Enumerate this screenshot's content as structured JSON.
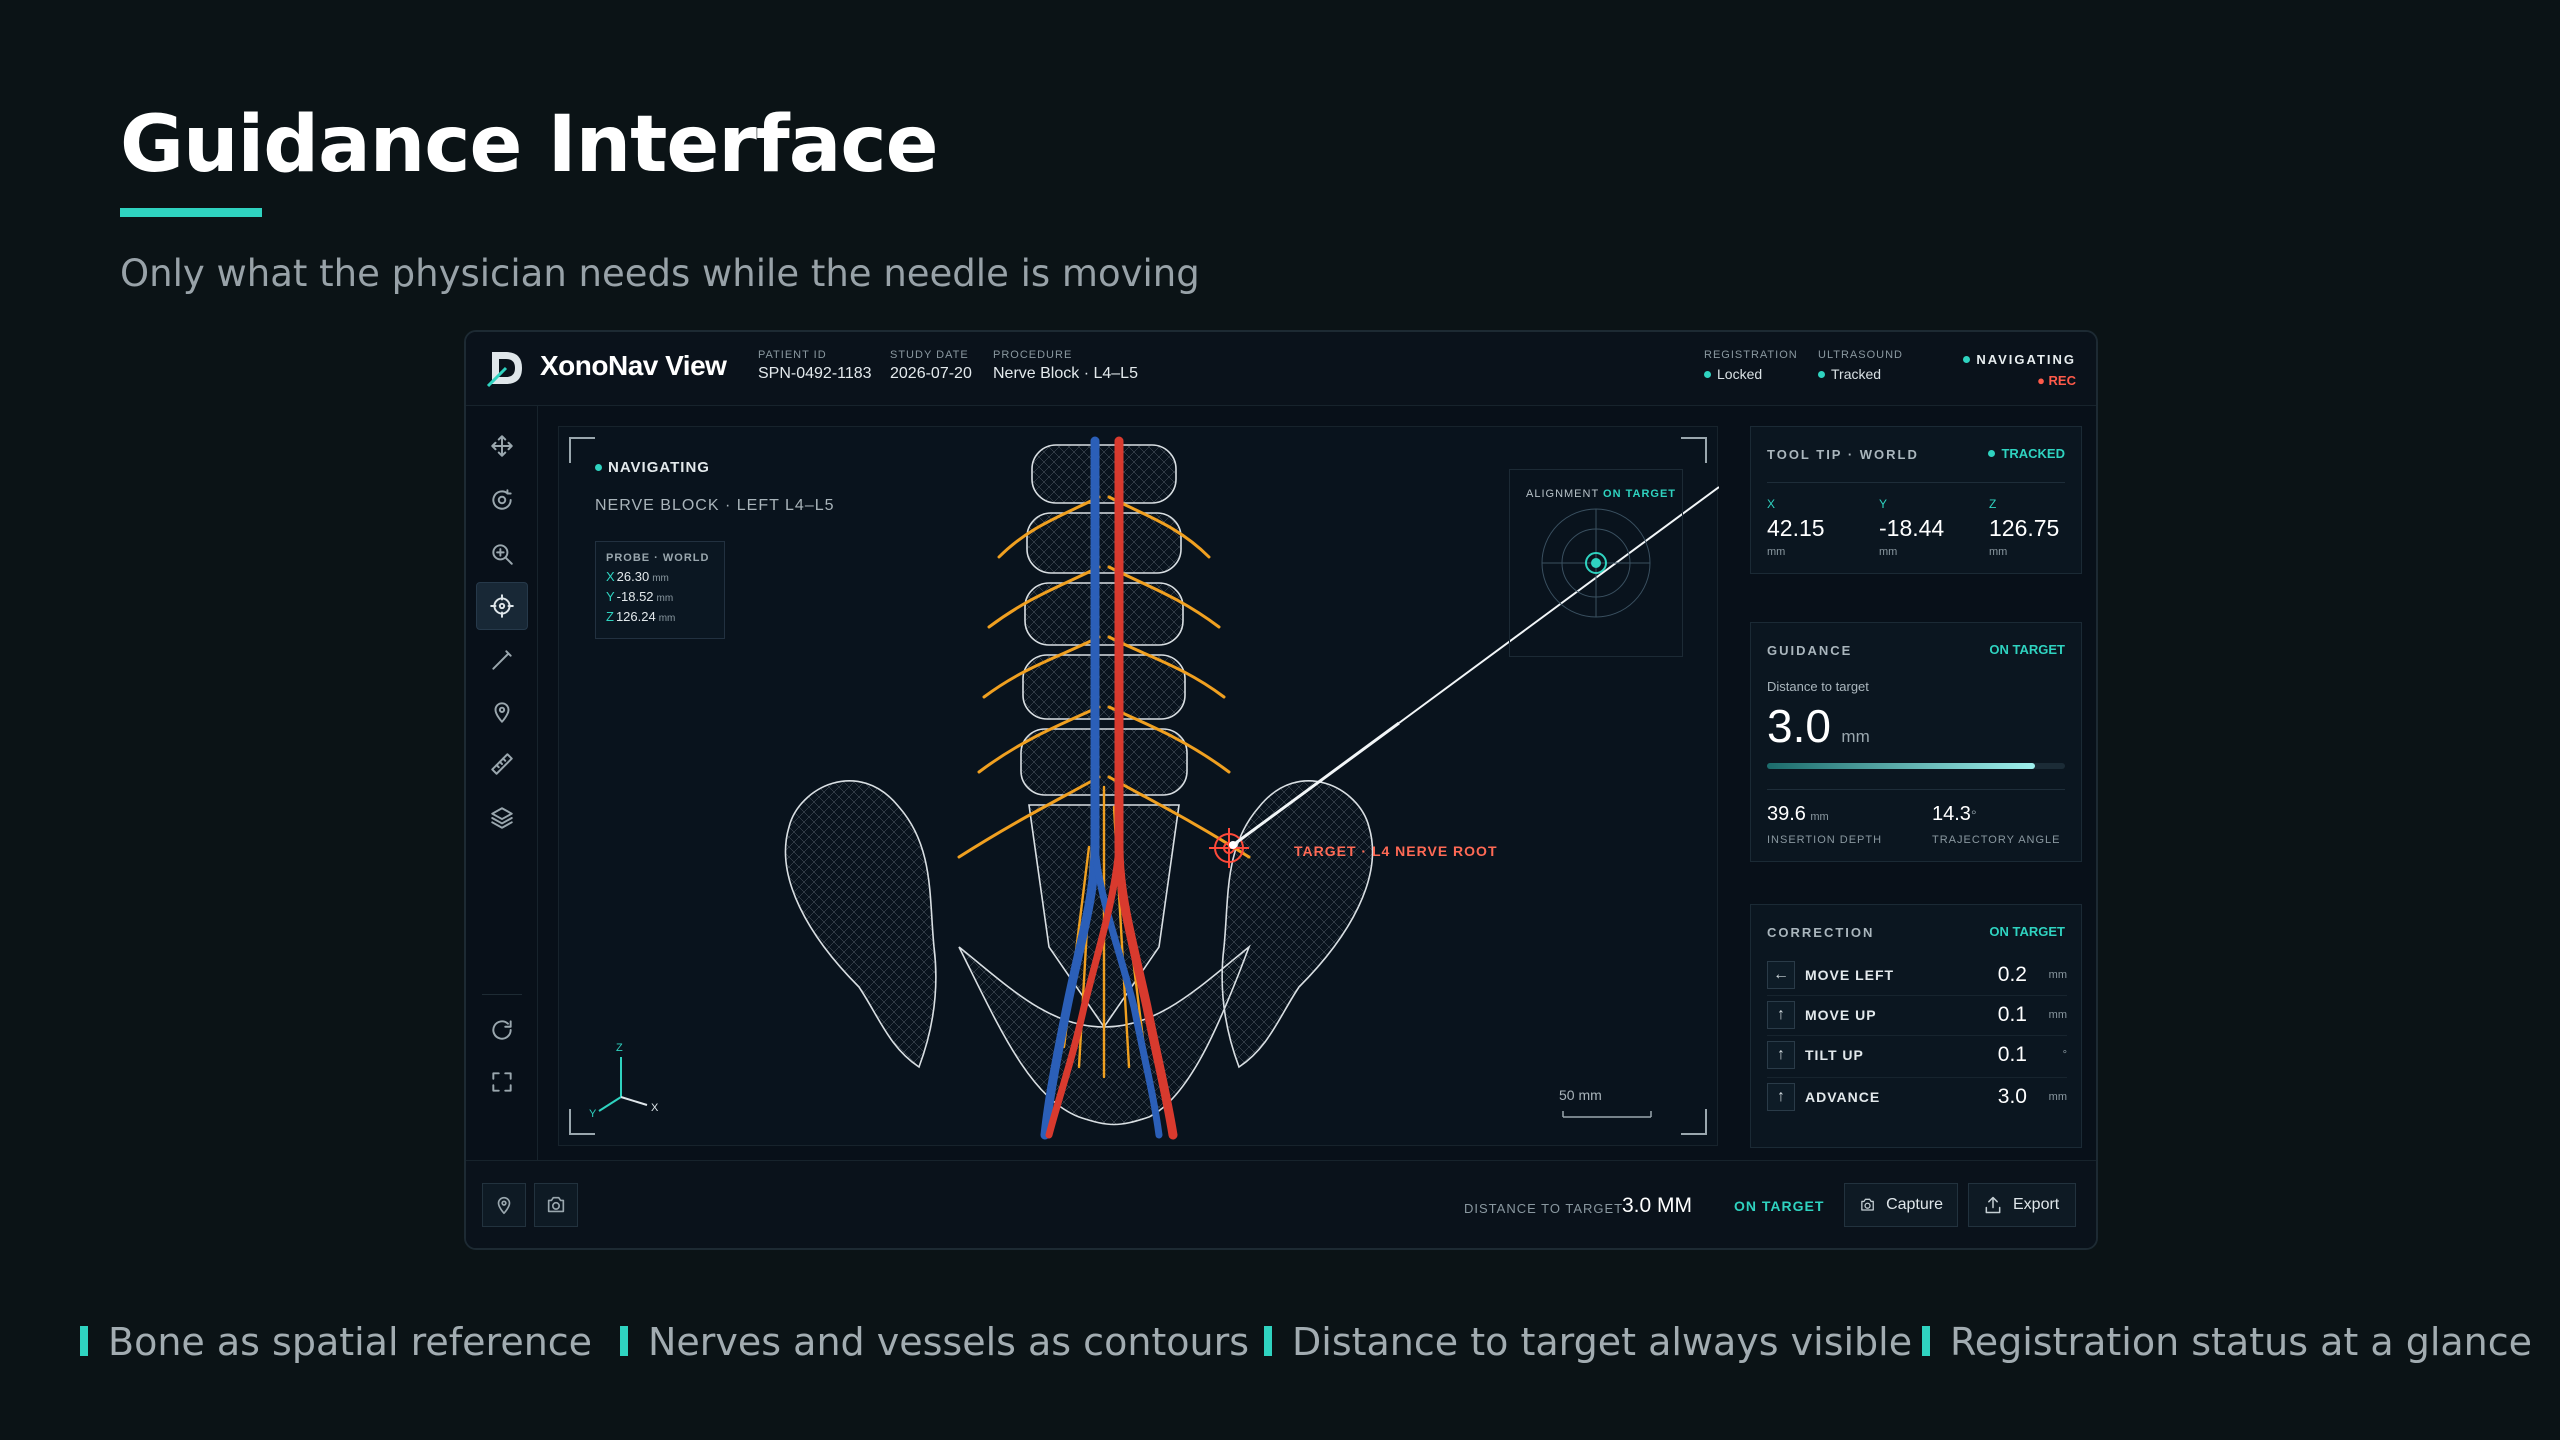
{
  "slide": {
    "title": "Guidance Interface",
    "subtitle": "Only what the physician needs while the needle is moving",
    "features": [
      "Bone as spatial reference",
      "Nerves and vessels as contours",
      "Distance to target always visible",
      "Registration status at a glance"
    ]
  },
  "app": {
    "brand": "XonoNav View",
    "meta": [
      {
        "label": "PATIENT ID",
        "value": "SPN-0492-1183"
      },
      {
        "label": "STUDY DATE",
        "value": "2026-07-20"
      },
      {
        "label": "PROCEDURE",
        "value": "Nerve Block · L4–L5"
      }
    ],
    "status": [
      {
        "label": "REGISTRATION",
        "value": "Locked"
      },
      {
        "label": "ULTRASOUND",
        "value": "Tracked"
      }
    ],
    "mode": "NAVIGATING",
    "rec": "● REC",
    "toolbar": [
      "move-icon",
      "rotate-icon",
      "zoom-icon",
      "target-icon",
      "needle-icon",
      "pin-icon",
      "ruler-icon",
      "layers-icon",
      "reset-icon",
      "fullscreen-icon"
    ],
    "active_tool": "target-icon"
  },
  "viewport": {
    "mode": "NAVIGATING",
    "procedure": "NERVE BLOCK · LEFT L4–L5",
    "probe": {
      "title": "PROBE · WORLD",
      "x": "26.30",
      "y": "-18.52",
      "z": "126.24",
      "unit": "mm",
      "ax_x": "X",
      "ax_y": "Y",
      "ax_z": "Z"
    },
    "alignment": {
      "label": "ALIGNMENT",
      "state": "ON TARGET"
    },
    "target_label": "TARGET · L4 NERVE ROOT",
    "scale": "50 mm",
    "axes": {
      "z": "Z",
      "y": "Y",
      "x": "X"
    },
    "colors": {
      "bone": "#d9dfe3",
      "nerve": "#f0a020",
      "artery": "#d83a2e",
      "vein": "#2b5fb8",
      "target": "#ff4a3a",
      "accent": "#2fd3c0"
    }
  },
  "tooltip_card": {
    "title": "TOOL TIP · WORLD",
    "state": "TRACKED",
    "coords": [
      {
        "axis": "X",
        "value": "42.15",
        "unit": "mm"
      },
      {
        "axis": "Y",
        "value": "-18.44",
        "unit": "mm"
      },
      {
        "axis": "Z",
        "value": "126.75",
        "unit": "mm"
      }
    ]
  },
  "guidance_card": {
    "title": "GUIDANCE",
    "state": "ON TARGET",
    "distance_label": "Distance to target",
    "distance_value": "3.0",
    "distance_unit": "mm",
    "progress_fraction": 0.9,
    "insertion_depth_value": "39.6",
    "insertion_depth_unit": "mm",
    "insertion_depth_label": "INSERTION DEPTH",
    "trajectory_value": "14.3",
    "trajectory_unit": "°",
    "trajectory_label": "TRAJECTORY ANGLE"
  },
  "correction_card": {
    "title": "CORRECTION",
    "state": "ON TARGET",
    "rows": [
      {
        "icon": "←",
        "label": "MOVE LEFT",
        "value": "0.2",
        "unit": "mm"
      },
      {
        "icon": "↑",
        "label": "MOVE UP",
        "value": "0.1",
        "unit": "mm"
      },
      {
        "icon": "↑",
        "label": "TILT UP",
        "value": "0.1",
        "unit": "°"
      },
      {
        "icon": "↑",
        "label": "ADVANCE",
        "value": "3.0",
        "unit": "mm"
      }
    ]
  },
  "bottombar": {
    "distance_label": "DISTANCE TO TARGET",
    "distance_value": "3.0 MM",
    "state": "ON TARGET",
    "capture": "Capture",
    "export": "Export"
  }
}
